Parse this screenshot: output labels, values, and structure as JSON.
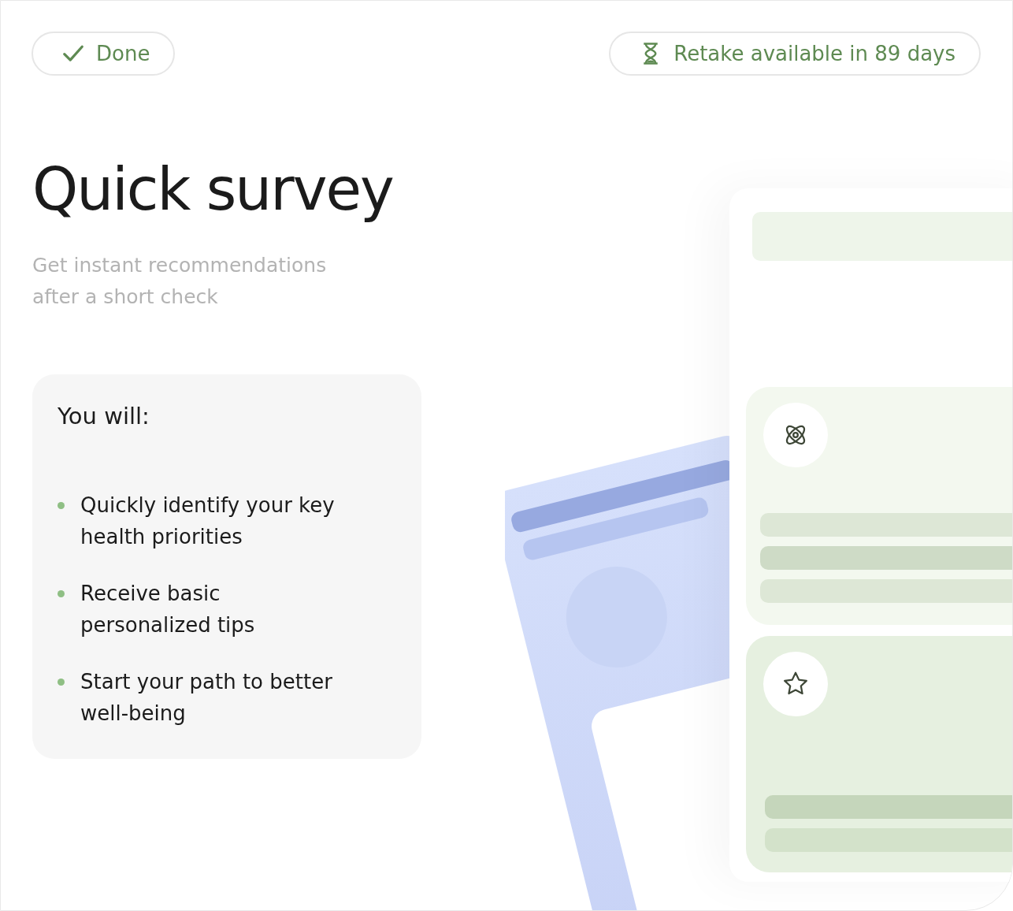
{
  "status": {
    "done_label": "Done",
    "retake_label": "Retake available in 89 days"
  },
  "title": "Quick survey",
  "subtitle": "Get instant recommendations after a short check",
  "benefits": {
    "heading": "You will:",
    "items": [
      "Quickly identify your key health priorities",
      "Receive basic personalized tips",
      "Start your path to better well-being"
    ]
  }
}
